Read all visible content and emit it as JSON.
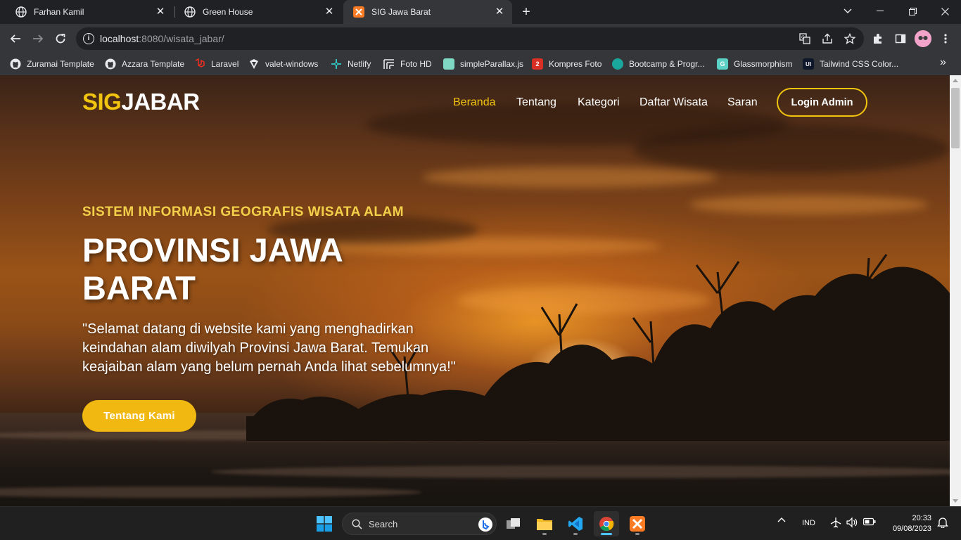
{
  "browser": {
    "tabs": [
      {
        "title": "Farhan Kamil",
        "favicon": "globe-icon",
        "active": false
      },
      {
        "title": "Green House",
        "favicon": "globe-icon",
        "active": false
      },
      {
        "title": "SIG Jawa Barat",
        "favicon": "xampp-icon",
        "active": true
      }
    ],
    "url_host": "localhost",
    "url_rest": ":8080/wisata_jabar/",
    "bookmarks": [
      {
        "label": "Zuramai Template",
        "icon": "github-icon"
      },
      {
        "label": "Azzara Template",
        "icon": "github-icon"
      },
      {
        "label": "Laravel",
        "icon": "laravel-icon"
      },
      {
        "label": "valet-windows",
        "icon": "valet-icon"
      },
      {
        "label": "Netlify",
        "icon": "netlify-icon"
      },
      {
        "label": "Foto HD",
        "icon": "unsplash-icon"
      },
      {
        "label": "simpleParallax.js",
        "icon": "parallax-icon"
      },
      {
        "label": "Kompres Foto",
        "icon": "compress-icon"
      },
      {
        "label": "Bootcamp & Progr...",
        "icon": "bootcamp-icon"
      },
      {
        "label": "Glassmorphism",
        "icon": "glass-icon"
      },
      {
        "label": "Tailwind CSS Color...",
        "icon": "ui-icon"
      }
    ]
  },
  "site": {
    "logo_sig": "SIG",
    "logo_jabar": "JABAR",
    "nav": [
      "Beranda",
      "Tentang",
      "Kategori",
      "Daftar Wisata",
      "Saran"
    ],
    "login_label": "Login Admin",
    "kicker": "SISTEM INFORMASI GEOGRAFIS WISATA ALAM",
    "headline": "PROVINSI JAWA BARAT",
    "lead": "\"Selamat datang di website kami yang menghadirkan keindahan alam diwilyah Provinsi Jawa Barat. Temukan keajaiban alam yang belum pernah Anda lihat sebelumnya!\"",
    "cta_label": "Tentang Kami"
  },
  "taskbar": {
    "search_label": "Search",
    "language": "IND",
    "time": "20:33",
    "date": "09/08/2023"
  },
  "colors": {
    "accent_yellow": "#f1c40f",
    "button_yellow": "#f1b811",
    "chrome_dark": "#202124",
    "chrome_toolbar": "#35363a"
  }
}
